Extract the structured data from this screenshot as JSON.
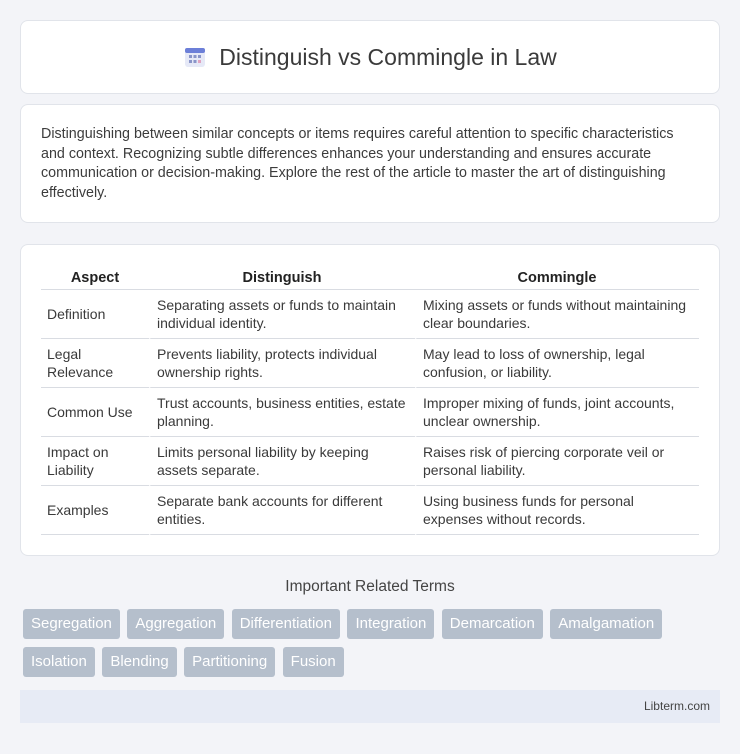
{
  "header": {
    "title": "Distinguish vs Commingle in Law",
    "icon": "calendar-icon"
  },
  "intro": {
    "text": "Distinguishing between similar concepts or items requires careful attention to specific characteristics and context. Recognizing subtle differences enhances your understanding and ensures accurate communication or decision-making. Explore the rest of the article to master the art of distinguishing effectively."
  },
  "table": {
    "headers": [
      "Aspect",
      "Distinguish",
      "Commingle"
    ],
    "rows": [
      {
        "aspect": "Definition",
        "distinguish": "Separating assets or funds to maintain individual identity.",
        "commingle": "Mixing assets or funds without maintaining clear boundaries."
      },
      {
        "aspect": "Legal Relevance",
        "distinguish": "Prevents liability, protects individual ownership rights.",
        "commingle": "May lead to loss of ownership, legal confusion, or liability."
      },
      {
        "aspect": "Common Use",
        "distinguish": "Trust accounts, business entities, estate planning.",
        "commingle": "Improper mixing of funds, joint accounts, unclear ownership."
      },
      {
        "aspect": "Impact on Liability",
        "distinguish": "Limits personal liability by keeping assets separate.",
        "commingle": "Raises risk of piercing corporate veil or personal liability."
      },
      {
        "aspect": "Examples",
        "distinguish": "Separate bank accounts for different entities.",
        "commingle": "Using business funds for personal expenses without records."
      }
    ]
  },
  "related": {
    "title": "Important Related Terms",
    "terms": [
      "Segregation",
      "Aggregation",
      "Differentiation",
      "Integration",
      "Demarcation",
      "Amalgamation",
      "Isolation",
      "Blending",
      "Partitioning",
      "Fusion"
    ]
  },
  "footer": {
    "site": "Libterm.com"
  },
  "colors": {
    "tag_bg": "#b5bfcc",
    "footer_bg": "#e7ebf5",
    "page_bg": "#f3f4f8"
  }
}
